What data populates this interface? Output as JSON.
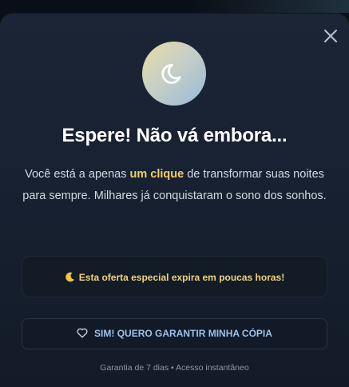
{
  "modal": {
    "title": "Espere! Não vá embora...",
    "description": {
      "part1": "Você está a apenas ",
      "highlight": "um clique",
      "part2": " de transformar suas noites para sempre. Milhares já conquistaram o sono dos sonhos."
    },
    "offer_text": "Esta oferta especial expira em poucas horas!",
    "cta_label": "SIM! QUERO GARANTIR MINHA CÓPIA",
    "guarantee_text": "Garantia de 7 dias • Acesso instantâneo"
  },
  "icons": {
    "close": "close-icon",
    "badge": "moon-icon",
    "offer": "crescent-moon-icon",
    "cta": "heart-icon"
  },
  "colors": {
    "highlight": "#f0cf63",
    "offer_text": "#f1d27a",
    "cta_text": "#9dc2ea",
    "modal_bg": "#1b2535"
  }
}
